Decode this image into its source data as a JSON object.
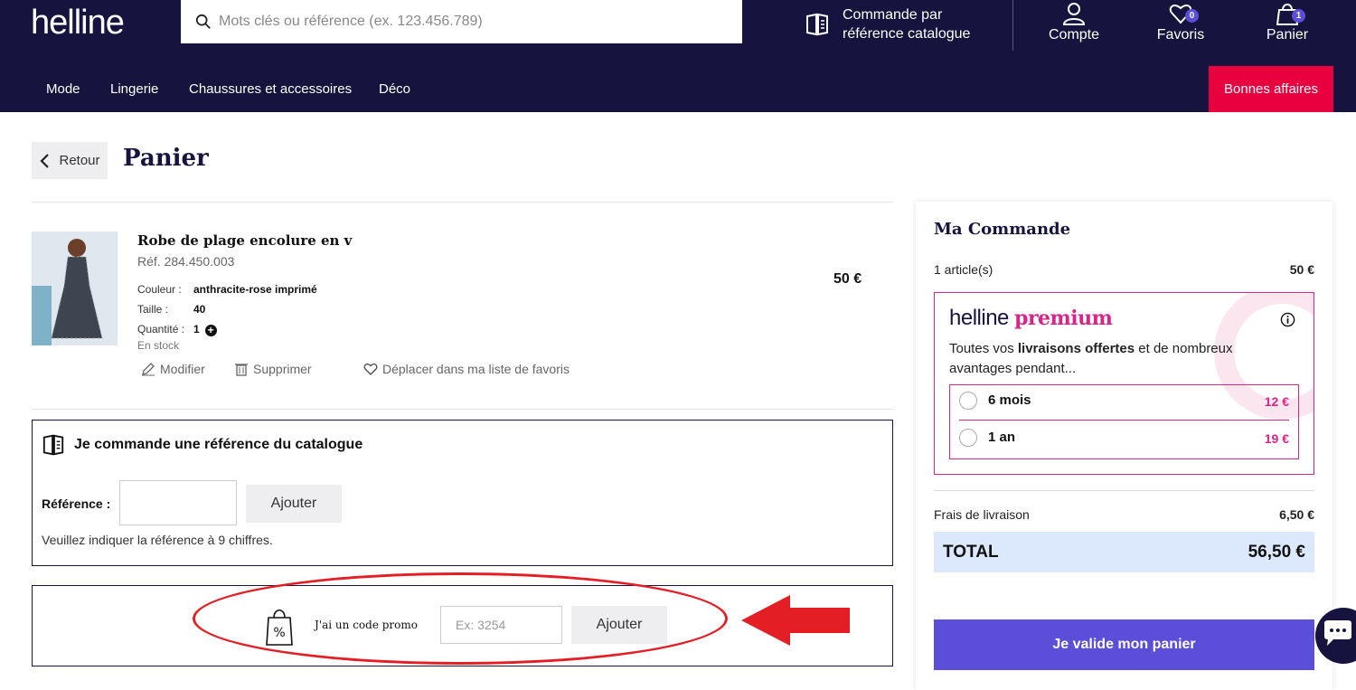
{
  "header": {
    "logo": "helline",
    "search_placeholder": "Mots clés ou référence (ex. 123.456.789)",
    "catalog_order_label": "Commande par référence catalogue",
    "account_label": "Compte",
    "favorites_label": "Favoris",
    "favorites_count": "0",
    "cart_label": "Panier",
    "cart_count": "1"
  },
  "nav": {
    "items": [
      "Mode",
      "Lingerie",
      "Chaussures et accessoires",
      "Déco"
    ],
    "deals_label": "Bonnes affaires"
  },
  "page": {
    "back_label": "Retour",
    "title": "Panier"
  },
  "item": {
    "name": "Robe de plage encolure en v",
    "ref": "Réf. 284.450.003",
    "color_label": "Couleur :",
    "color_value": "anthracite-rose imprimé",
    "size_label": "Taille :",
    "size_value": "40",
    "qty_label": "Quantité :",
    "qty_value": "1",
    "stock": "En stock",
    "price": "50 €",
    "modify_label": "Modifier",
    "delete_label": "Supprimer",
    "move_fav_label": "Déplacer dans ma liste de favoris"
  },
  "catalog_box": {
    "title": "Je commande une référence du catalogue",
    "ref_label": "Référence :",
    "add_label": "Ajouter",
    "hint": "Veuillez indiquer la référence à 9 chiffres."
  },
  "promo": {
    "label": "J'ai un code promo",
    "placeholder": "Ex: 3254",
    "add_label": "Ajouter"
  },
  "summary": {
    "title": "Ma Commande",
    "articles_label": "1 article(s)",
    "articles_value": "50 €",
    "premium_brand": "helline",
    "premium_word": "premium",
    "premium_text_pre": "Toutes vos ",
    "premium_text_bold": "livraisons offertes",
    "premium_text_post": " et de nombreux avantages pendant...",
    "plans": [
      {
        "name": "6 mois",
        "price": "12 €"
      },
      {
        "name": "1 an",
        "price": "19 €"
      }
    ],
    "shipping_label": "Frais de livraison",
    "shipping_value": "6,50 €",
    "total_label": "TOTAL",
    "total_value": "56,50 €",
    "validate_label": "Je valide mon panier"
  },
  "colors": {
    "navy": "#16143f",
    "deals_red": "#e8003f",
    "premium_pink": "#d6268a",
    "validate_purple": "#5b4ed8",
    "total_bg": "#dce8fb",
    "annotation_red": "#e31e24"
  },
  "icons": [
    "search-icon",
    "catalog-book-icon",
    "user-icon",
    "heart-icon",
    "bag-icon",
    "chevron-left-icon",
    "pencil-icon",
    "trash-icon",
    "heart-outline-icon",
    "promo-bag-icon",
    "info-icon",
    "chat-icon"
  ]
}
